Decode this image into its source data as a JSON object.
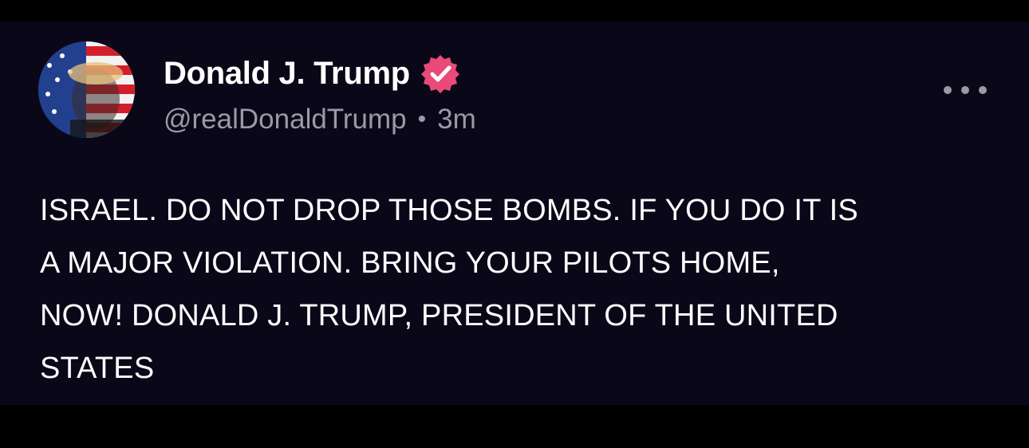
{
  "author": {
    "display_name": "Donald J. Trump",
    "handle": "@realDonaldTrump",
    "separator": "•",
    "time_ago": "3m",
    "verified_icon": "verified-badge-icon",
    "avatar_icon": "avatar-flag-portrait"
  },
  "post": {
    "lines": [
      "ISRAEL. DO NOT DROP THOSE BOMBS. IF YOU DO IT IS",
      "A MAJOR VIOLATION. BRING YOUR PILOTS HOME,",
      "NOW! DONALD J. TRUMP, PRESIDENT OF THE UNITED",
      "STATES"
    ]
  },
  "menu": {
    "icon": "more-options-icon"
  },
  "colors": {
    "background": "#0a0818",
    "text": "#ffffff",
    "secondary_text": "#9b98a8",
    "verified": "#e94a7a"
  }
}
